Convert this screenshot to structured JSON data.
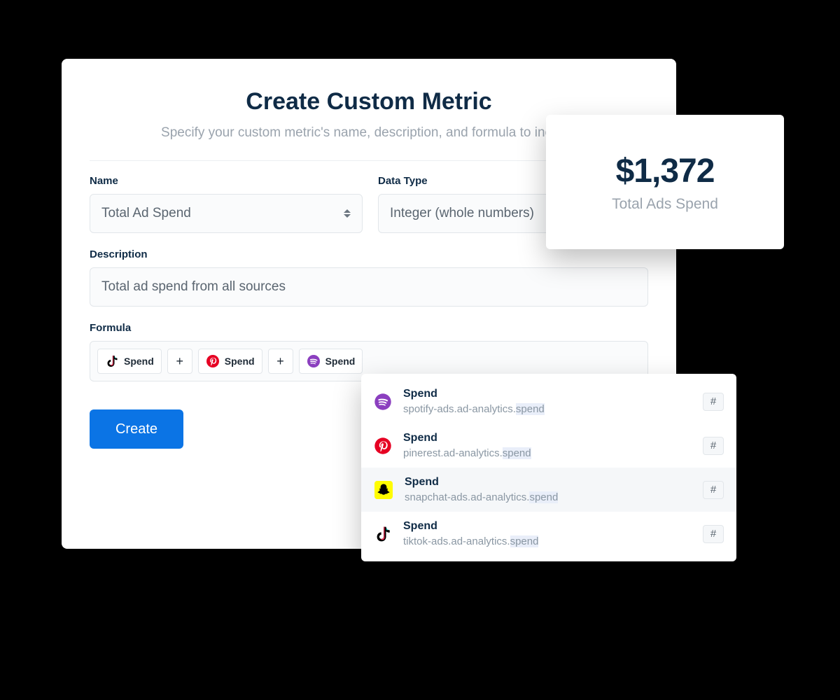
{
  "header": {
    "title": "Create Custom Metric",
    "subtitle": "Specify your custom metric's name, description, and formula to include"
  },
  "fields": {
    "name_label": "Name",
    "name_value": "Total Ad Spend",
    "datatype_label": "Data Type",
    "datatype_value": "Integer (whole numbers)",
    "description_label": "Description",
    "description_value": "Total ad spend from all sources",
    "formula_label": "Formula"
  },
  "formula_chips": [
    {
      "icon": "tiktok",
      "label": "Spend"
    },
    {
      "icon": "pinterest",
      "label": "Spend"
    },
    {
      "icon": "spotify",
      "label": "Spend"
    }
  ],
  "ops": {
    "plus": "+"
  },
  "buttons": {
    "create": "Create"
  },
  "stat": {
    "value": "$1,372",
    "label": "Total Ads Spend"
  },
  "dropdown": {
    "hash": "#",
    "items": [
      {
        "icon": "spotify",
        "title": "Spend",
        "path_prefix": "spotify-ads.ad-analytics.",
        "path_match": "spend"
      },
      {
        "icon": "pinterest",
        "title": "Spend",
        "path_prefix": "pinerest.ad-analytics.",
        "path_match": "spend"
      },
      {
        "icon": "snapchat",
        "title": "Spend",
        "path_prefix": "snapchat-ads.ad-analytics.",
        "path_match": "spend",
        "highlight": true
      },
      {
        "icon": "tiktok",
        "title": "Spend",
        "path_prefix": "tiktok-ads.ad-analytics.",
        "path_match": "spend"
      }
    ]
  }
}
